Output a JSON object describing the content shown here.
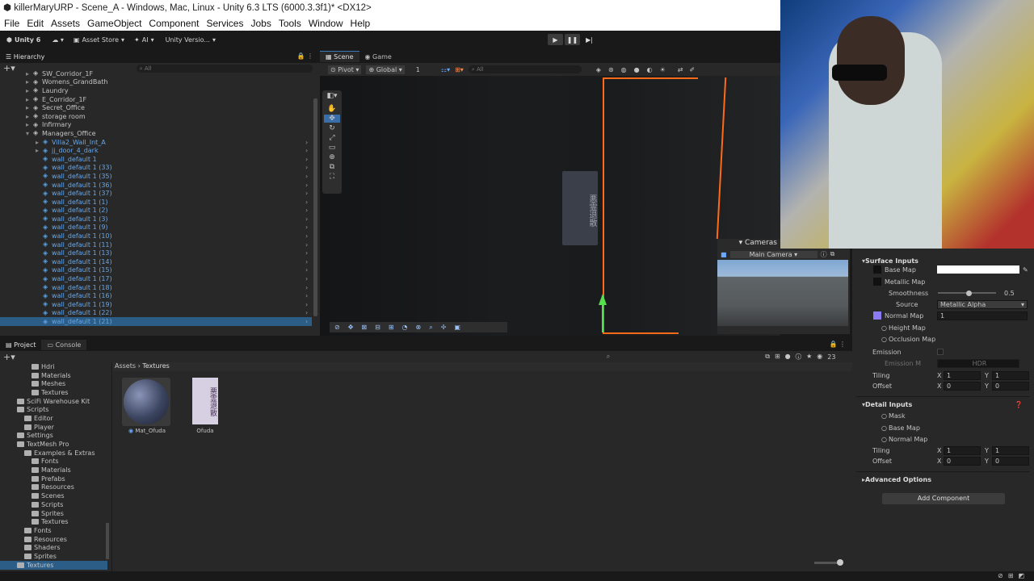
{
  "window": {
    "title": "killerMaryURP - Scene_A - Windows, Mac, Linux - Unity 6.3 LTS (6000.3.3f1)* <DX12>"
  },
  "menu": [
    "File",
    "Edit",
    "Assets",
    "GameObject",
    "Component",
    "Services",
    "Jobs",
    "Tools",
    "Window",
    "Help"
  ],
  "toolbar": {
    "account": "Unity 6",
    "asset_store": "Asset Store",
    "ai": "AI",
    "version_control": "Unity Versio..."
  },
  "hierarchy": {
    "tab": "Hierarchy",
    "search_placeholder": "All",
    "rows": [
      {
        "label": "SW_Corridor_1F",
        "indent": 1,
        "kind": "gray"
      },
      {
        "label": "Womens_GrandBath",
        "indent": 1,
        "kind": "gray"
      },
      {
        "label": "Laundry",
        "indent": 1,
        "kind": "gray"
      },
      {
        "label": "E_Corridor_1F",
        "indent": 1,
        "kind": "gray"
      },
      {
        "label": "Secret_Office",
        "indent": 1,
        "kind": "gray"
      },
      {
        "label": "storage room",
        "indent": 1,
        "kind": "gray"
      },
      {
        "label": "Infirmary",
        "indent": 1,
        "kind": "gray"
      },
      {
        "label": "Managers_Office",
        "indent": 1,
        "kind": "gray"
      },
      {
        "label": "Villa2_Wall_Int_A",
        "indent": 2,
        "kind": "blue"
      },
      {
        "label": "jj_door_4_dark",
        "indent": 2,
        "kind": "blue"
      },
      {
        "label": "wall_default 1",
        "indent": 2,
        "kind": "blue"
      },
      {
        "label": "wall_default 1 (33)",
        "indent": 2,
        "kind": "blue"
      },
      {
        "label": "wall_default 1 (35)",
        "indent": 2,
        "kind": "blue"
      },
      {
        "label": "wall_default 1 (36)",
        "indent": 2,
        "kind": "blue"
      },
      {
        "label": "wall_default 1 (37)",
        "indent": 2,
        "kind": "blue"
      },
      {
        "label": "wall_default 1 (1)",
        "indent": 2,
        "kind": "blue"
      },
      {
        "label": "wall_default 1 (2)",
        "indent": 2,
        "kind": "blue"
      },
      {
        "label": "wall_default 1 (3)",
        "indent": 2,
        "kind": "blue"
      },
      {
        "label": "wall_default 1 (9)",
        "indent": 2,
        "kind": "blue"
      },
      {
        "label": "wall_default 1 (10)",
        "indent": 2,
        "kind": "blue"
      },
      {
        "label": "wall_default 1 (11)",
        "indent": 2,
        "kind": "blue"
      },
      {
        "label": "wall_default 1 (13)",
        "indent": 2,
        "kind": "blue"
      },
      {
        "label": "wall_default 1 (14)",
        "indent": 2,
        "kind": "blue"
      },
      {
        "label": "wall_default 1 (15)",
        "indent": 2,
        "kind": "blue"
      },
      {
        "label": "wall_default 1 (17)",
        "indent": 2,
        "kind": "blue"
      },
      {
        "label": "wall_default 1 (18)",
        "indent": 2,
        "kind": "blue"
      },
      {
        "label": "wall_default 1 (16)",
        "indent": 2,
        "kind": "blue"
      },
      {
        "label": "wall_default 1 (19)",
        "indent": 2,
        "kind": "blue"
      },
      {
        "label": "wall_default 1 (22)",
        "indent": 2,
        "kind": "blue"
      },
      {
        "label": "wall_default 1 (21)",
        "indent": 2,
        "kind": "blue"
      }
    ]
  },
  "scene": {
    "tab_scene": "Scene",
    "tab_game": "Game",
    "pivot": "Pivot",
    "global": "Global",
    "grid_size": "1",
    "search_placeholder": "All",
    "cameras_overlay": "Cameras",
    "camera_select": "Main Camera"
  },
  "project": {
    "tab_project": "Project",
    "tab_console": "Console",
    "breadcrumb": [
      "Assets",
      "Textures"
    ],
    "item_count": "23",
    "tree": [
      {
        "label": "Hdri",
        "indent": 3
      },
      {
        "label": "Materials",
        "indent": 3
      },
      {
        "label": "Meshes",
        "indent": 3
      },
      {
        "label": "Textures",
        "indent": 3
      },
      {
        "label": "SciFi Warehouse Kit",
        "indent": 1
      },
      {
        "label": "Scripts",
        "indent": 1
      },
      {
        "label": "Editor",
        "indent": 2
      },
      {
        "label": "Player",
        "indent": 2
      },
      {
        "label": "Settings",
        "indent": 1
      },
      {
        "label": "TextMesh Pro",
        "indent": 1
      },
      {
        "label": "Examples & Extras",
        "indent": 2
      },
      {
        "label": "Fonts",
        "indent": 3
      },
      {
        "label": "Materials",
        "indent": 3
      },
      {
        "label": "Prefabs",
        "indent": 3
      },
      {
        "label": "Resources",
        "indent": 3
      },
      {
        "label": "Scenes",
        "indent": 3
      },
      {
        "label": "Scripts",
        "indent": 3
      },
      {
        "label": "Sprites",
        "indent": 3
      },
      {
        "label": "Textures",
        "indent": 3
      },
      {
        "label": "Fonts",
        "indent": 2
      },
      {
        "label": "Resources",
        "indent": 2
      },
      {
        "label": "Shaders",
        "indent": 2
      },
      {
        "label": "Sprites",
        "indent": 2
      },
      {
        "label": "Textures",
        "indent": 1
      }
    ],
    "assets": [
      {
        "name": "Mat_Ofuda",
        "kind": "material"
      },
      {
        "name": "Ofuda",
        "kind": "texture"
      }
    ]
  },
  "inspector": {
    "surface_inputs": "Surface Inputs",
    "base_map": "Base Map",
    "metallic_map": "Metallic Map",
    "smoothness": "Smoothness",
    "smoothness_value": "0.5",
    "source": "Source",
    "source_value": "Metallic Alpha",
    "normal_map": "Normal Map",
    "normal_value": "1",
    "height_map": "Height Map",
    "occlusion_map": "Occlusion Map",
    "emission": "Emission",
    "emission_map": "Emission M",
    "emission_hdr": "HDR",
    "tiling": "Tiling",
    "offset": "Offset",
    "x": "X",
    "y": "Y",
    "tiling_x": "1",
    "tiling_y": "1",
    "offset_x": "0",
    "offset_y": "0",
    "detail_inputs": "Detail Inputs",
    "mask": "Mask",
    "detail_base_map": "Base Map",
    "detail_normal_map": "Normal Map",
    "detail_tiling_x": "1",
    "detail_tiling_y": "1",
    "detail_offset_x": "0",
    "detail_offset_y": "0",
    "advanced_options": "Advanced Options",
    "add_component": "Add Component"
  }
}
